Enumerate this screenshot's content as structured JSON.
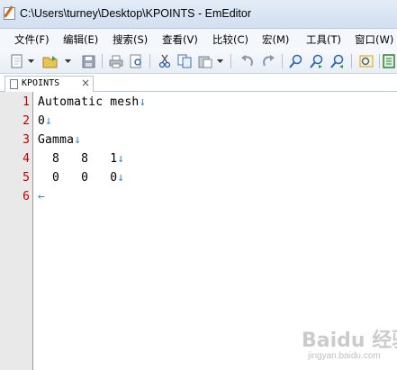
{
  "window": {
    "title": "C:\\Users\\turney\\Desktop\\KPOINTS - EmEditor"
  },
  "menu": [
    {
      "label": "文件(F)"
    },
    {
      "label": "编辑(E)"
    },
    {
      "label": "搜索(S)"
    },
    {
      "label": "查看(V)"
    },
    {
      "label": "比较(C)"
    },
    {
      "label": "宏(M)"
    },
    {
      "label": "工具(T)"
    },
    {
      "label": "窗口(W)"
    }
  ],
  "toolbar": {
    "icons": [
      "new-file-icon",
      "dropdown-arrow-icon",
      "open-folder-icon",
      "dropdown-arrow-icon",
      "save-icon",
      "print-icon",
      "print-preview-icon",
      "cut-icon",
      "copy-icon",
      "paste-icon",
      "dropdown-arrow-icon",
      "undo-icon",
      "redo-icon",
      "find-icon",
      "find-next-icon",
      "find-prev-icon",
      "search-highlight-icon",
      "view-mode-icon"
    ]
  },
  "tab": {
    "label": "KPOINTS",
    "close": "×"
  },
  "editor": {
    "lines": [
      {
        "num": "1",
        "text": "Automatic mesh",
        "eol": "↓"
      },
      {
        "num": "2",
        "text": "0",
        "eol": "↓"
      },
      {
        "num": "3",
        "text": "Gamma",
        "eol": "↓"
      },
      {
        "num": "4",
        "text": "  8   8   1",
        "eol": "↓"
      },
      {
        "num": "5",
        "text": "  0   0   0",
        "eol": "↓"
      },
      {
        "num": "6",
        "text": "",
        "eol": "←"
      }
    ]
  },
  "watermark": {
    "text": "Baidu 经验",
    "sub": "jingyan.baidu.com"
  },
  "colors": {
    "line_number": "#c00000",
    "eol_marker": "#2f8ad6",
    "gutter_bg": "#e9e9e9"
  }
}
